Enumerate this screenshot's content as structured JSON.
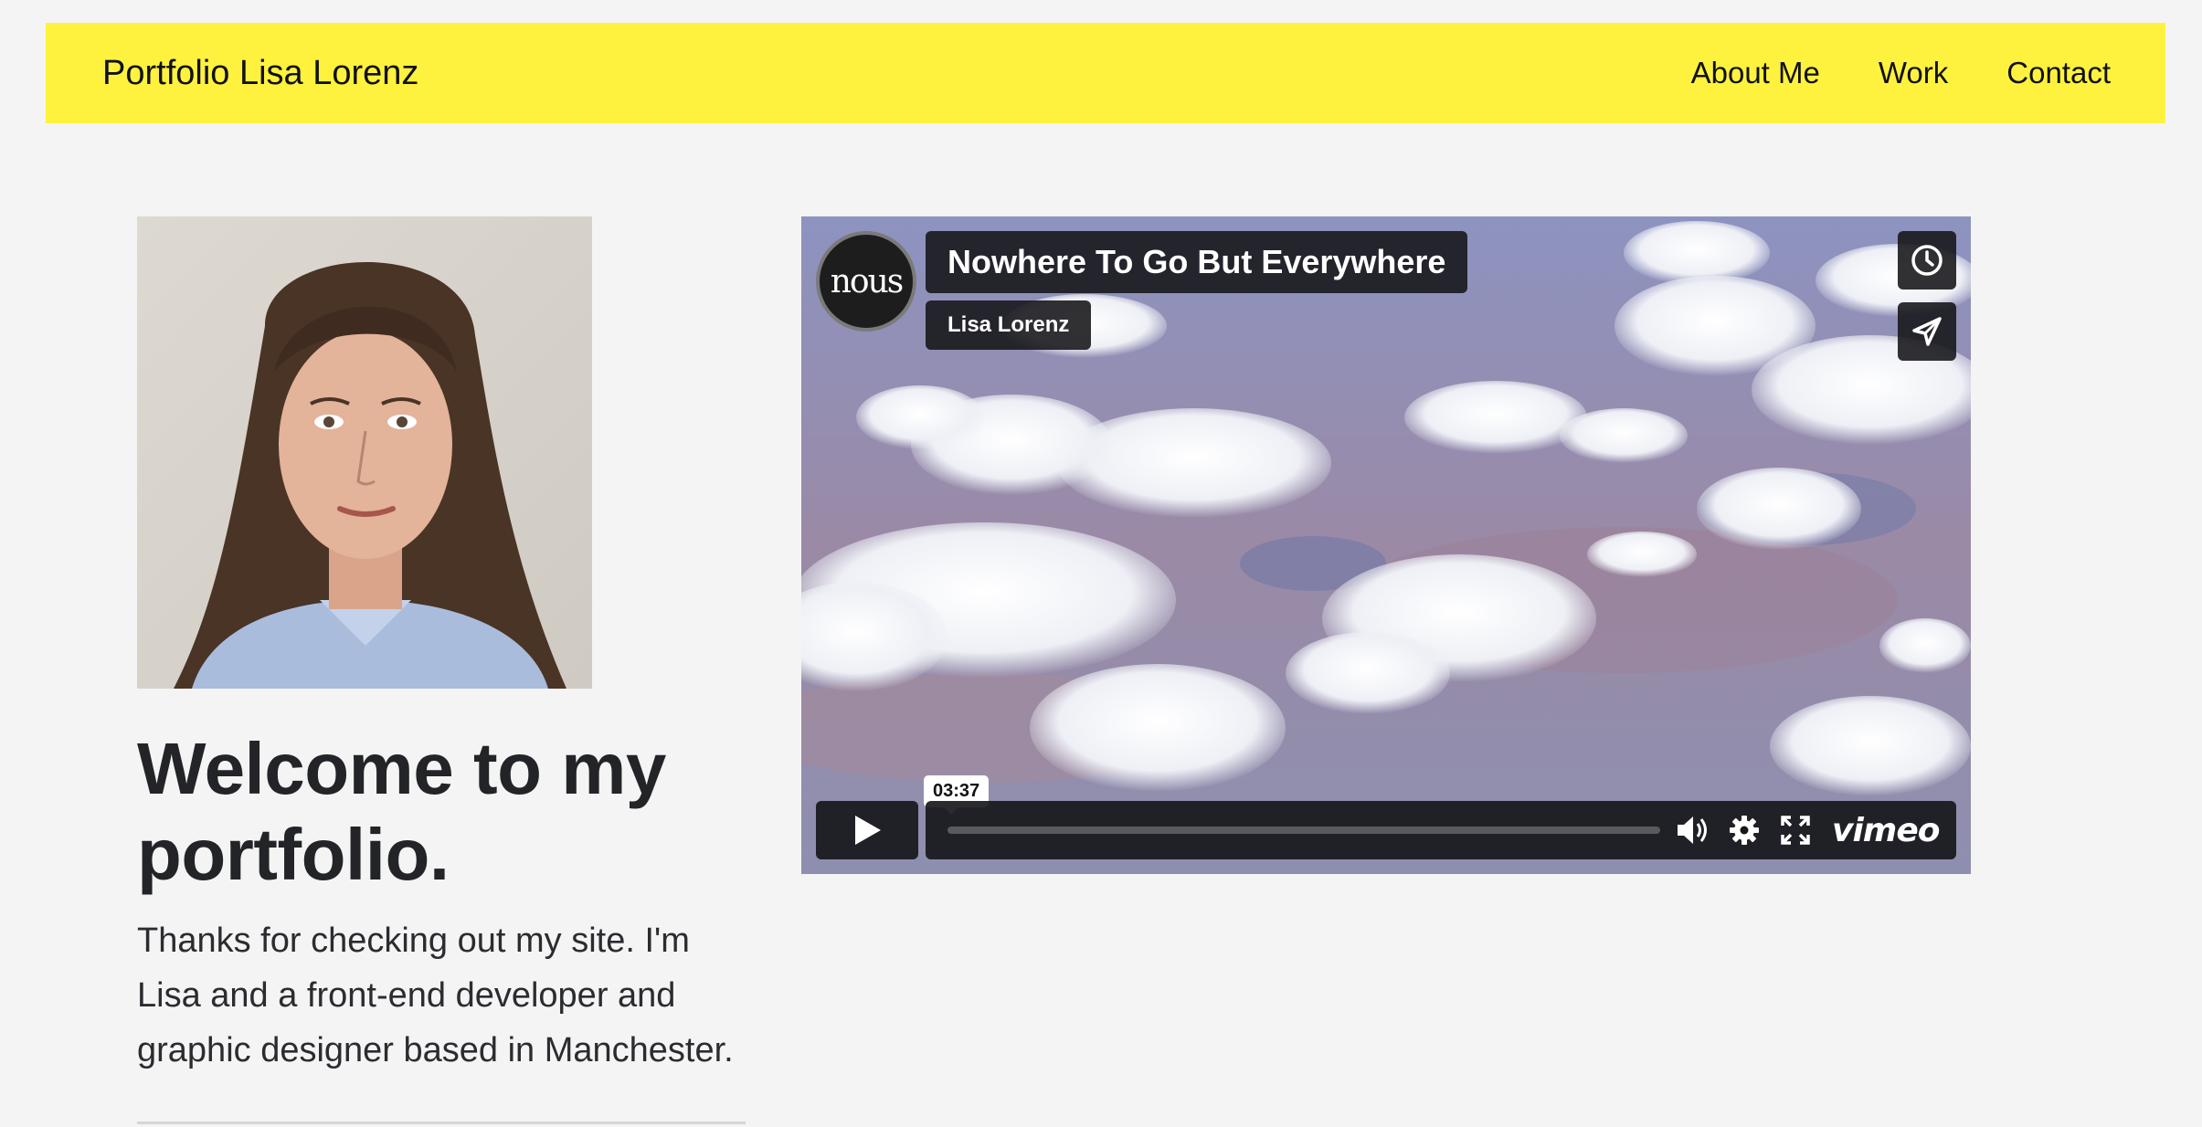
{
  "navbar": {
    "brand": "Portfolio Lisa Lorenz",
    "links": [
      "About Me",
      "Work",
      "Contact"
    ],
    "background": "#fff23e"
  },
  "hero": {
    "headline": "Welcome to my portfolio.",
    "intro": "Thanks for checking out my site. I'm Lisa and a front-end developer and graphic designer based in Manchester."
  },
  "video": {
    "channel_logo": "nous",
    "title": "Nowhere To Go But Everywhere",
    "author": "Lisa Lorenz",
    "duration": "03:37",
    "progress": 0,
    "provider": "vimeo",
    "icons": {
      "watch_later": "clock-icon",
      "share": "paper-plane-icon",
      "play": "play-icon",
      "volume": "volume-icon",
      "settings": "gear-icon",
      "fullscreen": "fullscreen-icon"
    }
  }
}
